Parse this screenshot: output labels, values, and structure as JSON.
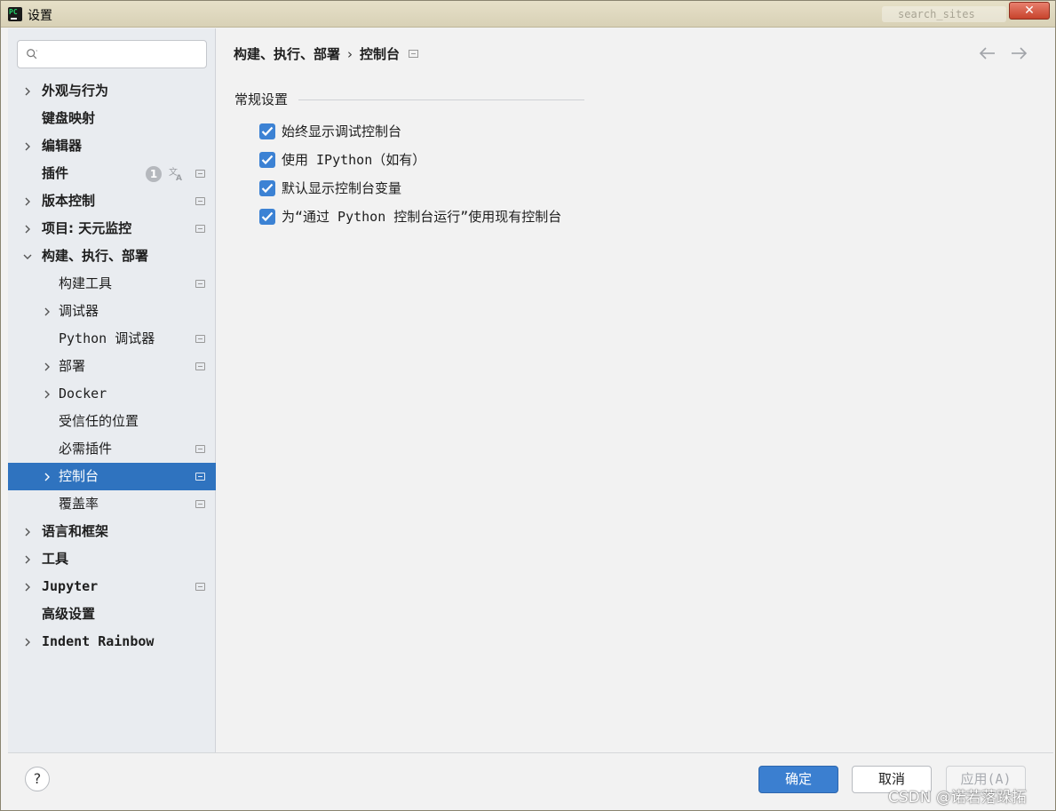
{
  "window": {
    "title": "设置",
    "app_icon_text": "PC",
    "close_label": "✕",
    "ghost_search": "search_sites"
  },
  "sidebar": {
    "search_placeholder": "",
    "items": [
      {
        "label": "外观与行为",
        "level": 0,
        "expandable": true,
        "proj": false
      },
      {
        "label": "键盘映射",
        "level": 0,
        "expandable": false,
        "proj": false
      },
      {
        "label": "编辑器",
        "level": 0,
        "expandable": true,
        "proj": false
      },
      {
        "label": "插件",
        "level": 0,
        "expandable": false,
        "proj": true,
        "badge": "1"
      },
      {
        "label": "版本控制",
        "level": 0,
        "expandable": true,
        "proj": true
      },
      {
        "label": "项目: 天元监控",
        "level": 0,
        "expandable": true,
        "proj": true
      },
      {
        "label": "构建、执行、部署",
        "level": 0,
        "expandable": true,
        "expanded": true,
        "proj": false
      },
      {
        "label": "构建工具",
        "level": 1,
        "expandable": false,
        "proj": true
      },
      {
        "label": "调试器",
        "level": 1,
        "expandable": true,
        "proj": false
      },
      {
        "label": "Python 调试器",
        "level": 1,
        "expandable": false,
        "proj": true
      },
      {
        "label": "部署",
        "level": 1,
        "expandable": true,
        "proj": true
      },
      {
        "label": "Docker",
        "level": 1,
        "expandable": true,
        "proj": false
      },
      {
        "label": "受信任的位置",
        "level": 1,
        "expandable": false,
        "proj": false
      },
      {
        "label": "必需插件",
        "level": 1,
        "expandable": false,
        "proj": true
      },
      {
        "label": "控制台",
        "level": 1,
        "expandable": true,
        "proj": true,
        "selected": true
      },
      {
        "label": "覆盖率",
        "level": 1,
        "expandable": false,
        "proj": true
      },
      {
        "label": "语言和框架",
        "level": 0,
        "expandable": true,
        "proj": false
      },
      {
        "label": "工具",
        "level": 0,
        "expandable": true,
        "proj": false
      },
      {
        "label": "Jupyter",
        "level": 0,
        "expandable": true,
        "proj": true
      },
      {
        "label": "高级设置",
        "level": 0,
        "expandable": false,
        "proj": false
      },
      {
        "label": "Indent Rainbow",
        "level": 0,
        "expandable": true,
        "proj": false
      }
    ]
  },
  "content": {
    "breadcrumb": [
      "构建、执行、部署",
      "控制台"
    ],
    "breadcrumb_sep": "›",
    "section_title": "常规设置",
    "options": [
      {
        "label": "始终显示调试控制台",
        "checked": true
      },
      {
        "label": "使用 IPython（如有）",
        "checked": true
      },
      {
        "label": "默认显示控制台变量",
        "checked": true
      },
      {
        "label": "为“通过 Python 控制台运行”使用现有控制台",
        "checked": true
      }
    ]
  },
  "footer": {
    "help_label": "?",
    "ok_label": "确定",
    "cancel_label": "取消",
    "apply_label": "应用(A)"
  },
  "watermark": "CSDN @诺若落跺拓",
  "colors": {
    "accent": "#2f73bf",
    "checkbox": "#3c82d4",
    "ok_button": "#3b7fd0"
  }
}
